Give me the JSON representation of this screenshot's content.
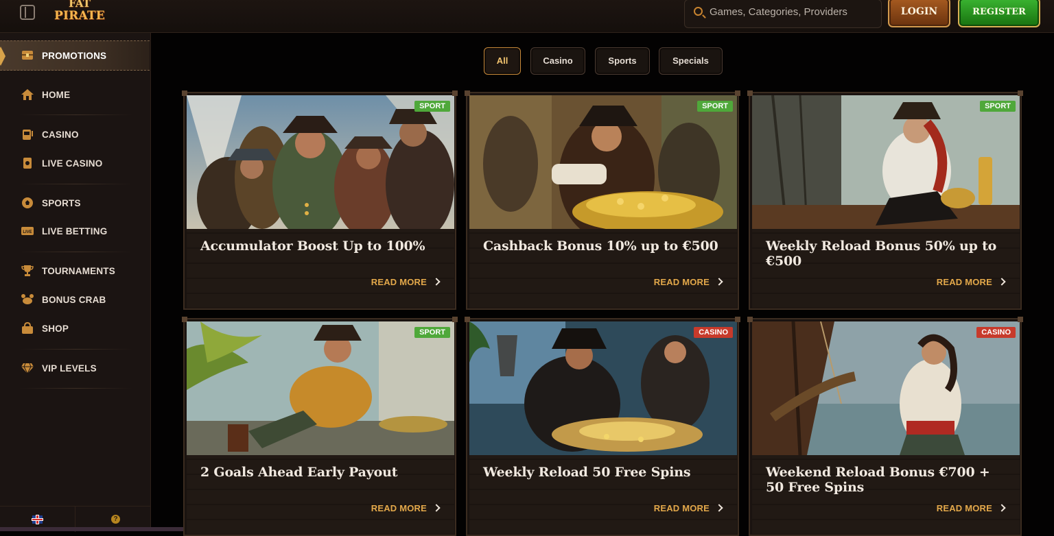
{
  "header": {
    "logo_top": "FAT",
    "logo_bottom": "PIRATE",
    "search_placeholder": "Games, Categories, Providers",
    "login_label": "LOGIN",
    "register_label": "REGISTER"
  },
  "sidebar": {
    "items": [
      {
        "label": "PROMOTIONS",
        "icon": "treasure-chest-icon",
        "active": true
      },
      {
        "label": "HOME",
        "icon": "home-icon"
      },
      {
        "label": "CASINO",
        "icon": "slot-machine-icon"
      },
      {
        "label": "LIVE CASINO",
        "icon": "card-icon"
      },
      {
        "label": "SPORTS",
        "icon": "soccer-ball-icon"
      },
      {
        "label": "LIVE BETTING",
        "icon": "live-icon"
      },
      {
        "label": "TOURNAMENTS",
        "icon": "trophy-icon"
      },
      {
        "label": "BONUS CRAB",
        "icon": "crab-icon"
      },
      {
        "label": "SHOP",
        "icon": "shopping-bag-icon"
      },
      {
        "label": "VIP LEVELS",
        "icon": "diamond-icon"
      }
    ],
    "footer": {
      "language_icon": "uk-flag-icon",
      "help_icon": "help-icon"
    }
  },
  "filters": [
    {
      "label": "All",
      "active": true
    },
    {
      "label": "Casino"
    },
    {
      "label": "Sports"
    },
    {
      "label": "Specials"
    }
  ],
  "promotions": [
    {
      "title": "Accumulator Boost Up to 100%",
      "badge": "SPORT",
      "read_more": "READ MORE"
    },
    {
      "title": "Cashback Bonus 10% up to €500",
      "badge": "SPORT",
      "read_more": "READ MORE"
    },
    {
      "title": "Weekly Reload Bonus 50% up to €500",
      "badge": "SPORT",
      "read_more": "READ MORE"
    },
    {
      "title": "2 Goals Ahead Early Payout",
      "badge": "SPORT",
      "read_more": "READ MORE"
    },
    {
      "title": "Weekly Reload 50 Free Spins",
      "badge": "CASINO",
      "read_more": "READ MORE"
    },
    {
      "title": "Weekend Reload Bonus €700 + 50 Free Spins",
      "badge": "CASINO",
      "read_more": "READ MORE"
    }
  ],
  "colors": {
    "accent": "#e3a84a",
    "sport_badge": "#4fa83a",
    "casino_badge": "#c73a2b",
    "register_green": "#2f9e27",
    "login_brown": "#8b4716"
  }
}
